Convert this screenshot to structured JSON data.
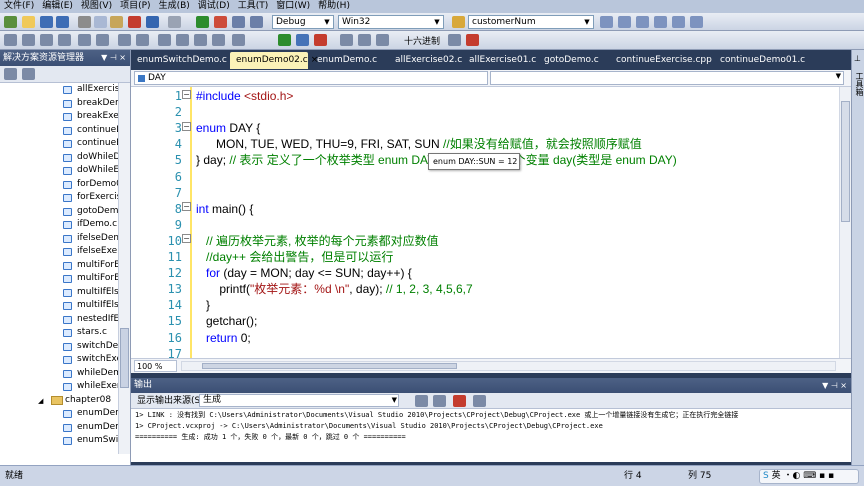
{
  "menu": [
    "文件(F)",
    "编辑(E)",
    "视图(V)",
    "项目(P)",
    "生成(B)",
    "调试(D)",
    "工具(T)",
    "窗口(W)",
    "帮助(H)"
  ],
  "toolbar": {
    "config": "Debug",
    "platform": "Win32",
    "find_value": "customerNum",
    "hex_label": "十六进制"
  },
  "solution_explorer": {
    "title": "解决方案资源管理器",
    "items": [
      {
        "type": "file",
        "label": "allExercise"
      },
      {
        "type": "file",
        "label": "breakDem"
      },
      {
        "type": "file",
        "label": "breakExer"
      },
      {
        "type": "file",
        "label": "continueD"
      },
      {
        "type": "file",
        "label": "continueEx"
      },
      {
        "type": "file",
        "label": "doWhileD"
      },
      {
        "type": "file",
        "label": "doWhileEx"
      },
      {
        "type": "file",
        "label": "forDemo0"
      },
      {
        "type": "file",
        "label": "forExercis"
      },
      {
        "type": "file",
        "label": "gotoDemo"
      },
      {
        "type": "file",
        "label": "ifDemo.c"
      },
      {
        "type": "file",
        "label": "ifelseDem"
      },
      {
        "type": "file",
        "label": "ifelseExer"
      },
      {
        "type": "file",
        "label": "multiForEx"
      },
      {
        "type": "file",
        "label": "multiForEx"
      },
      {
        "type": "file",
        "label": "multiIfElse"
      },
      {
        "type": "file",
        "label": "multiIfElse"
      },
      {
        "type": "file",
        "label": "nestedIfEl"
      },
      {
        "type": "file",
        "label": "stars.c"
      },
      {
        "type": "file",
        "label": "switchDem"
      },
      {
        "type": "file",
        "label": "switchExer"
      },
      {
        "type": "file",
        "label": "whileDemo"
      },
      {
        "type": "file",
        "label": "whileExerc"
      },
      {
        "type": "folder",
        "label": "chapter08"
      },
      {
        "type": "file",
        "label": "enumDem"
      },
      {
        "type": "file",
        "label": "enumDem"
      },
      {
        "type": "file",
        "label": "enumSwitc"
      }
    ]
  },
  "tabs": [
    {
      "label": "enumSwitchDemo.c",
      "active": false
    },
    {
      "label": "enumDemo02.c",
      "active": true
    },
    {
      "label": "enumDemo.c",
      "active": false
    },
    {
      "label": "allExercise02.c",
      "active": false
    },
    {
      "label": "allExercise01.c",
      "active": false
    },
    {
      "label": "gotoDemo.c",
      "active": false
    },
    {
      "label": "continueExercise.cpp",
      "active": false
    },
    {
      "label": "continueDemo01.c",
      "active": false
    }
  ],
  "tab_close": "×",
  "editor": {
    "nav_scope": "DAY",
    "zoom": "100 %",
    "lines": [
      {
        "n": "1",
        "parts": [
          {
            "c": "pre",
            "t": "#include "
          },
          {
            "c": "str",
            "t": "<stdio.h>"
          }
        ]
      },
      {
        "n": "2",
        "parts": []
      },
      {
        "n": "3",
        "parts": [
          {
            "c": "kw",
            "t": "enum"
          },
          {
            "c": "",
            "t": " DAY {"
          }
        ]
      },
      {
        "n": "4",
        "parts": [
          {
            "c": "",
            "t": "      MON, TUE, WED, THU=9, FRI, SAT, SUN "
          },
          {
            "c": "cm",
            "t": "//如果没有给赋值，就会按照顺序赋值"
          }
        ]
      },
      {
        "n": "5",
        "parts": [
          {
            "c": "",
            "t": "} day; "
          },
          {
            "c": "cm",
            "t": "// 表示 定义了一个枚举类型 enum DAY ,同时定义了一个变量 day(类型是 enum DAY)"
          }
        ]
      },
      {
        "n": "6",
        "parts": []
      },
      {
        "n": "7",
        "parts": []
      },
      {
        "n": "8",
        "parts": [
          {
            "c": "kw",
            "t": "int"
          },
          {
            "c": "",
            "t": " main() {"
          }
        ]
      },
      {
        "n": "9",
        "parts": []
      },
      {
        "n": "10",
        "parts": [
          {
            "c": "",
            "t": "   "
          },
          {
            "c": "cm",
            "t": "// 遍历枚举元素, 枚举的每个元素都对应数值"
          }
        ]
      },
      {
        "n": "11",
        "parts": [
          {
            "c": "",
            "t": "   "
          },
          {
            "c": "cm",
            "t": "//day++ 会给出警告，但是可以运行"
          }
        ]
      },
      {
        "n": "12",
        "parts": [
          {
            "c": "",
            "t": "   "
          },
          {
            "c": "kw",
            "t": "for"
          },
          {
            "c": "",
            "t": " (day = MON; day <= SUN; day++) {"
          }
        ]
      },
      {
        "n": "13",
        "parts": [
          {
            "c": "",
            "t": "       printf("
          },
          {
            "c": "str",
            "t": "\"枚举元素：%d \\n\""
          },
          {
            "c": "",
            "t": ", day); "
          },
          {
            "c": "cm",
            "t": "// 1, 2, 3, 4,5,6,7"
          }
        ]
      },
      {
        "n": "14",
        "parts": [
          {
            "c": "",
            "t": "   }"
          }
        ]
      },
      {
        "n": "15",
        "parts": [
          {
            "c": "",
            "t": "   getchar();"
          }
        ]
      },
      {
        "n": "16",
        "parts": [
          {
            "c": "",
            "t": "   "
          },
          {
            "c": "kw",
            "t": "return"
          },
          {
            "c": "",
            "t": " 0;"
          }
        ]
      },
      {
        "n": "17",
        "parts": []
      }
    ],
    "tooltip": "enum DAY::SUN = 12"
  },
  "output": {
    "title": "输出",
    "source_label": "显示输出来源(S):",
    "source_value": "生成",
    "lines": [
      "1>  LINK : 没有找到 C:\\Users\\Administrator\\Documents\\Visual Studio 2010\\Projects\\CProject\\Debug\\CProject.exe 或上一个增量链接没有生成它；正在执行完全链接",
      "1>  CProject.vcxproj -> C:\\Users\\Administrator\\Documents\\Visual Studio 2010\\Projects\\CProject\\Debug\\CProject.exe",
      "========== 生成: 成功 1 个，失败 0 个，最新 0 个，跳过 0 个 =========="
    ]
  },
  "status": {
    "ready": "就绪",
    "row": "行 4",
    "col": "列 75",
    "ime_label": "英"
  },
  "right_strip_label": "工具箱",
  "colors": {
    "frame": "#2b3c59",
    "active_tab": "#fbf2b8",
    "keyword": "#0000ff",
    "comment": "#008000",
    "string": "#a31515",
    "line_number": "#2b91af"
  }
}
